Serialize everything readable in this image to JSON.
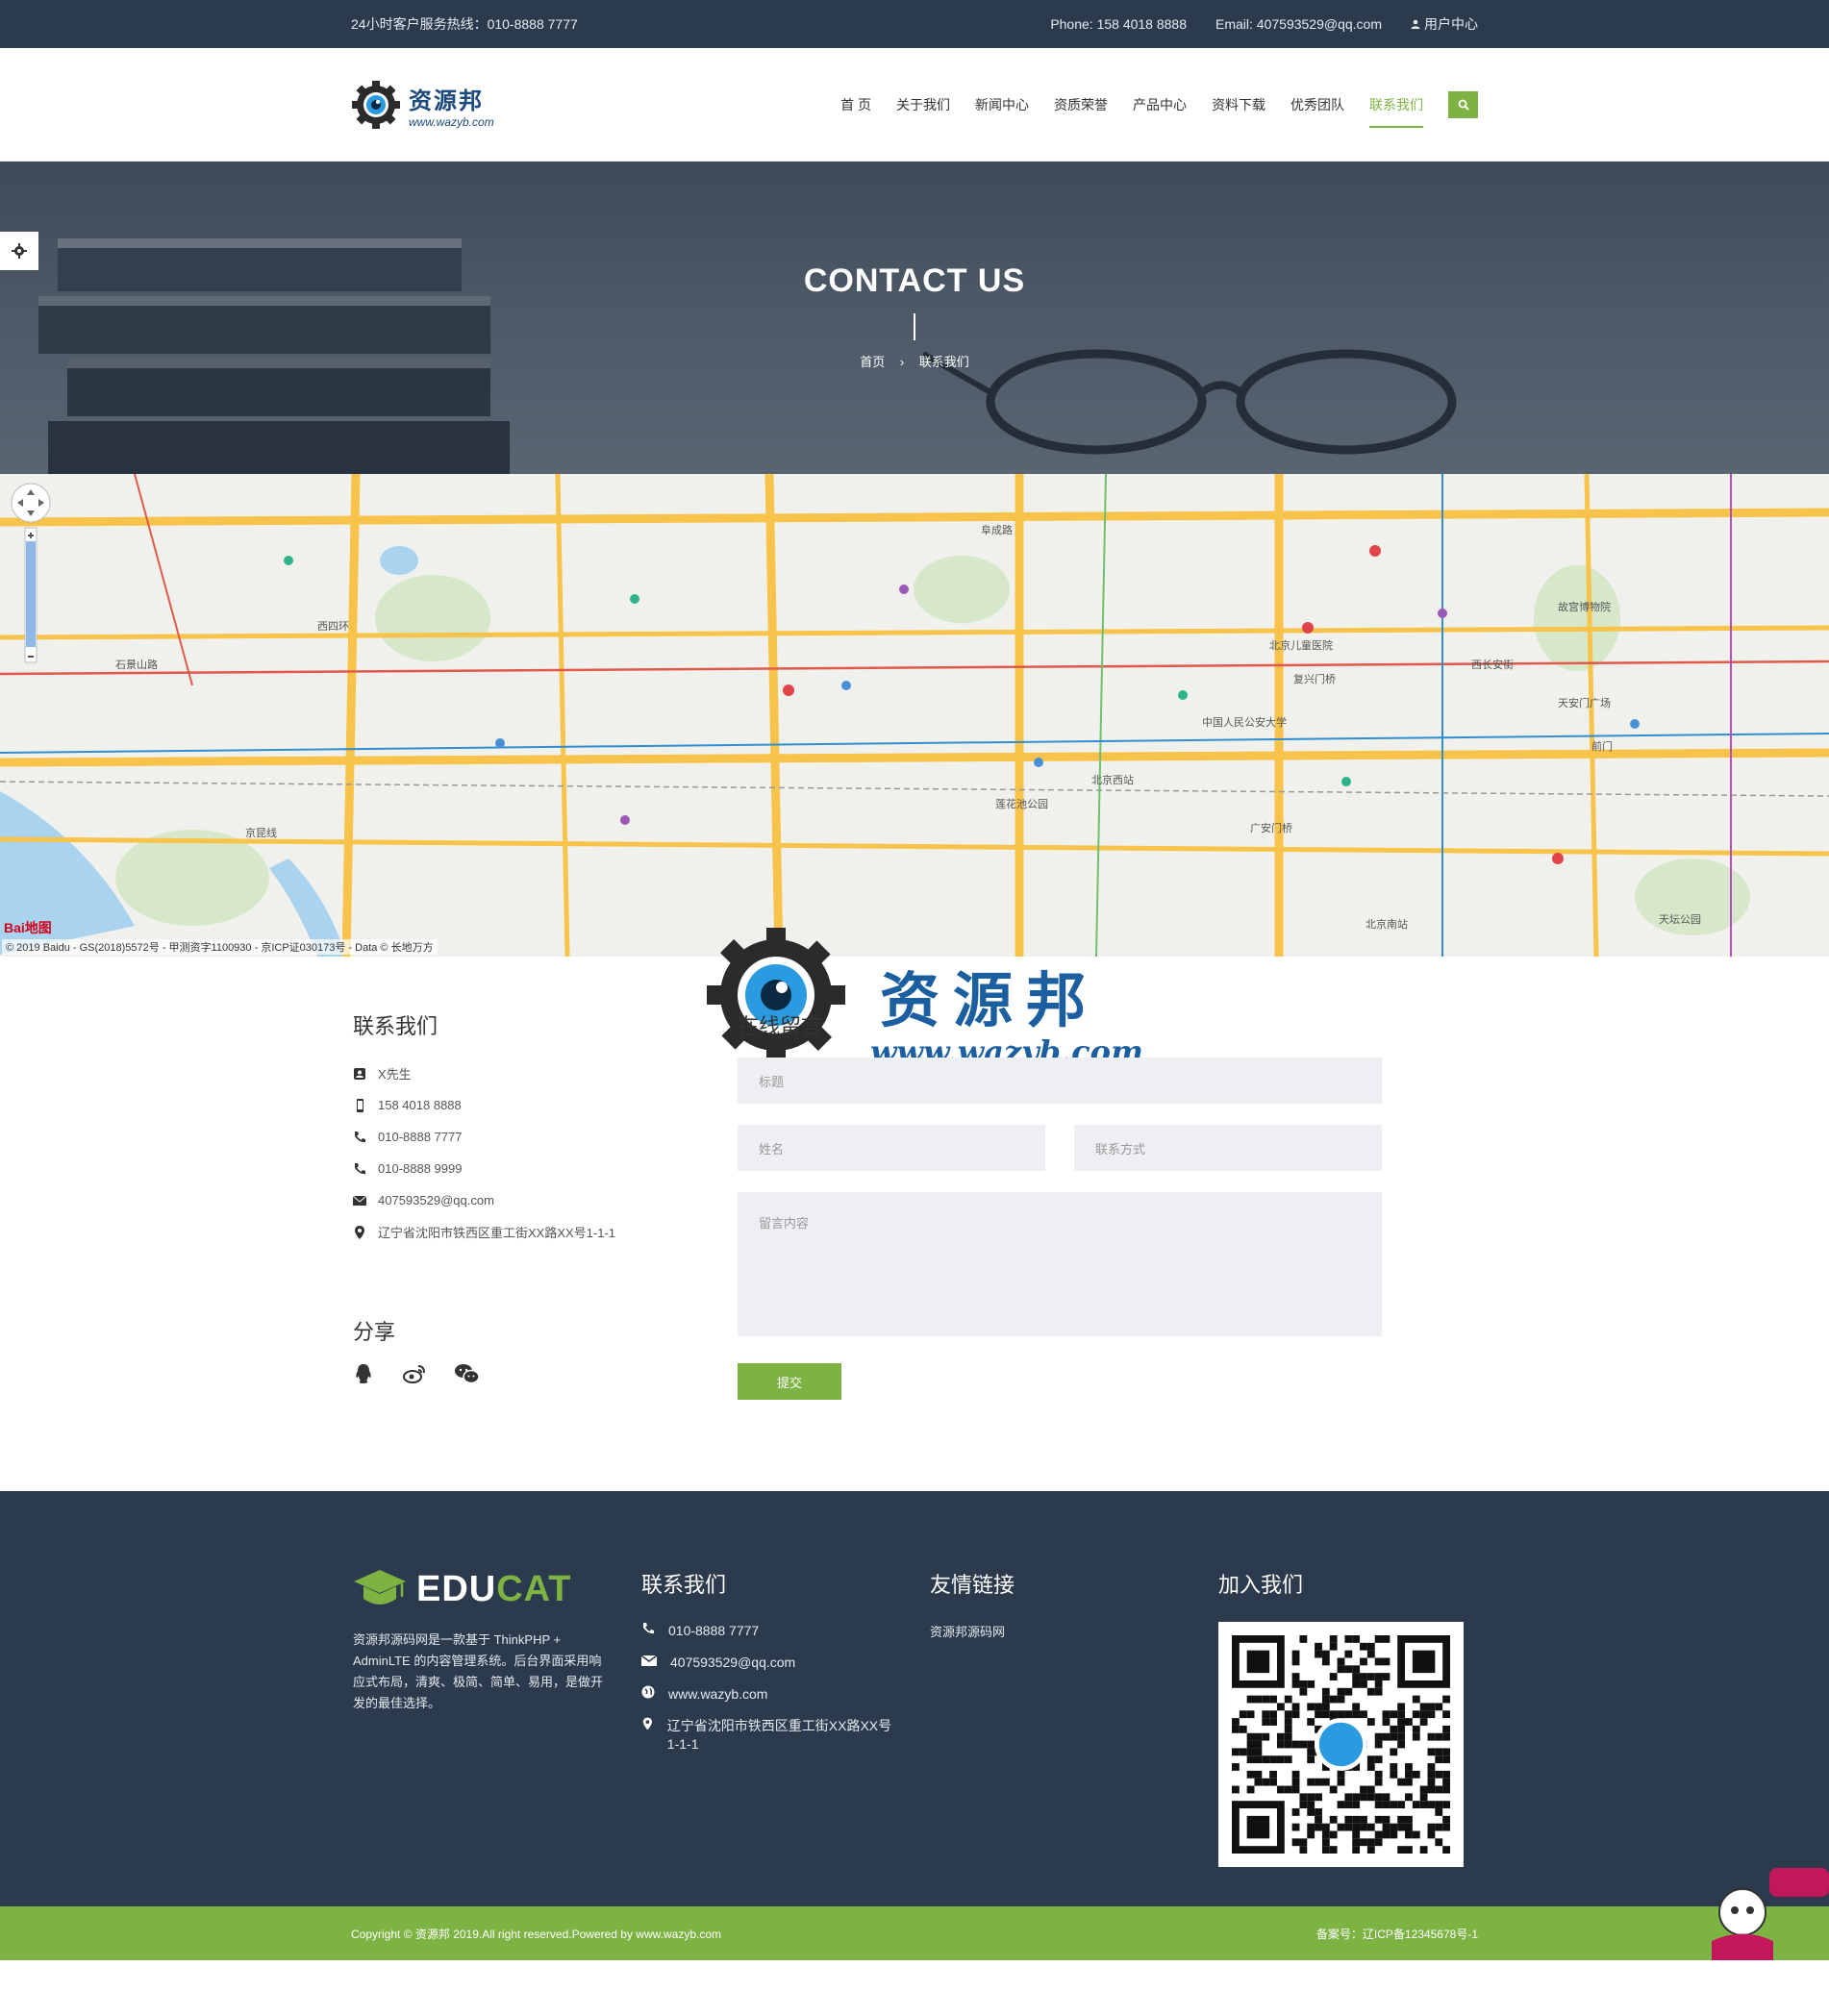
{
  "topbar": {
    "hotline": "24小时客户服务热线：010-8888 7777",
    "phone": "Phone: 158 4018 8888",
    "email": "Email: 407593529@qq.com",
    "user_center": "用户中心"
  },
  "logo": {
    "name": "资源邦",
    "url": "www.wazyb.com"
  },
  "nav": {
    "items": [
      {
        "label": "首 页"
      },
      {
        "label": "关于我们"
      },
      {
        "label": "新闻中心"
      },
      {
        "label": "资质荣誉"
      },
      {
        "label": "产品中心"
      },
      {
        "label": "资料下载"
      },
      {
        "label": "优秀团队"
      },
      {
        "label": "联系我们",
        "active": true
      }
    ]
  },
  "banner": {
    "title": "CONTACT US",
    "crumb_home": "首页",
    "crumb_sep": "›",
    "crumb_current": "联系我们"
  },
  "map": {
    "copyright": "© 2019 Baidu - GS(2018)5572号 - 甲测资字1100930 - 京ICP证030173号 - Data © 长地万方",
    "labels": [
      "石景山路",
      "阜成路",
      "西四环",
      "西长安街",
      "复兴门桥",
      "中国人民公安大学",
      "北京西站",
      "故宫博物院",
      "天安门广场",
      "北京儿童医院",
      "北京南站",
      "京昆线",
      "莲花池公园",
      "广安门桥",
      "天坛公园",
      "前门"
    ],
    "logo": "Bai地图"
  },
  "contact": {
    "title": "联系我们",
    "items": [
      {
        "icon": "user-icon",
        "text": "X先生"
      },
      {
        "icon": "mobile-icon",
        "text": "158 4018 8888"
      },
      {
        "icon": "phone-icon",
        "text": "010-8888 7777"
      },
      {
        "icon": "phone-icon",
        "text": "010-8888 9999"
      },
      {
        "icon": "mail-icon",
        "text": "407593529@qq.com"
      },
      {
        "icon": "location-icon",
        "text": "辽宁省沈阳市铁西区重工街XX路XX号1-1-1"
      }
    ],
    "share_title": "分享"
  },
  "form": {
    "title": "在线留言",
    "title_placeholder": "标题",
    "name_placeholder": "姓名",
    "contact_placeholder": "联系方式",
    "message_placeholder": "留言内容",
    "submit": "提交"
  },
  "watermark": {
    "cn": "资源邦",
    "url": "www.wazyb.com"
  },
  "footer": {
    "brand_a": "EDU",
    "brand_b": "CAT",
    "about": "资源邦源码网是一款基于 ThinkPHP + AdminLTE 的内容管理系统。后台界面采用响应式布局，清爽、极简、简单、易用，是做开发的最佳选择。",
    "contact_title": "联系我们",
    "contact_items": [
      {
        "icon": "phone-icon",
        "text": "010-8888 7777"
      },
      {
        "icon": "mail-icon",
        "text": "407593529@qq.com"
      },
      {
        "icon": "globe-icon",
        "text": "www.wazyb.com"
      },
      {
        "icon": "location-icon",
        "text": "辽宁省沈阳市铁西区重工街XX路XX号1-1-1"
      }
    ],
    "links_title": "友情链接",
    "links": [
      "资源邦源码网"
    ],
    "join_title": "加入我们"
  },
  "copyright": {
    "left": "Copyright © 资源邦 2019.All right reserved.Powered by www.wazyb.com",
    "right": "备案号：辽ICP备12345678号-1"
  },
  "colors": {
    "accent": "#7cb342",
    "dark": "#2c3a4d"
  }
}
